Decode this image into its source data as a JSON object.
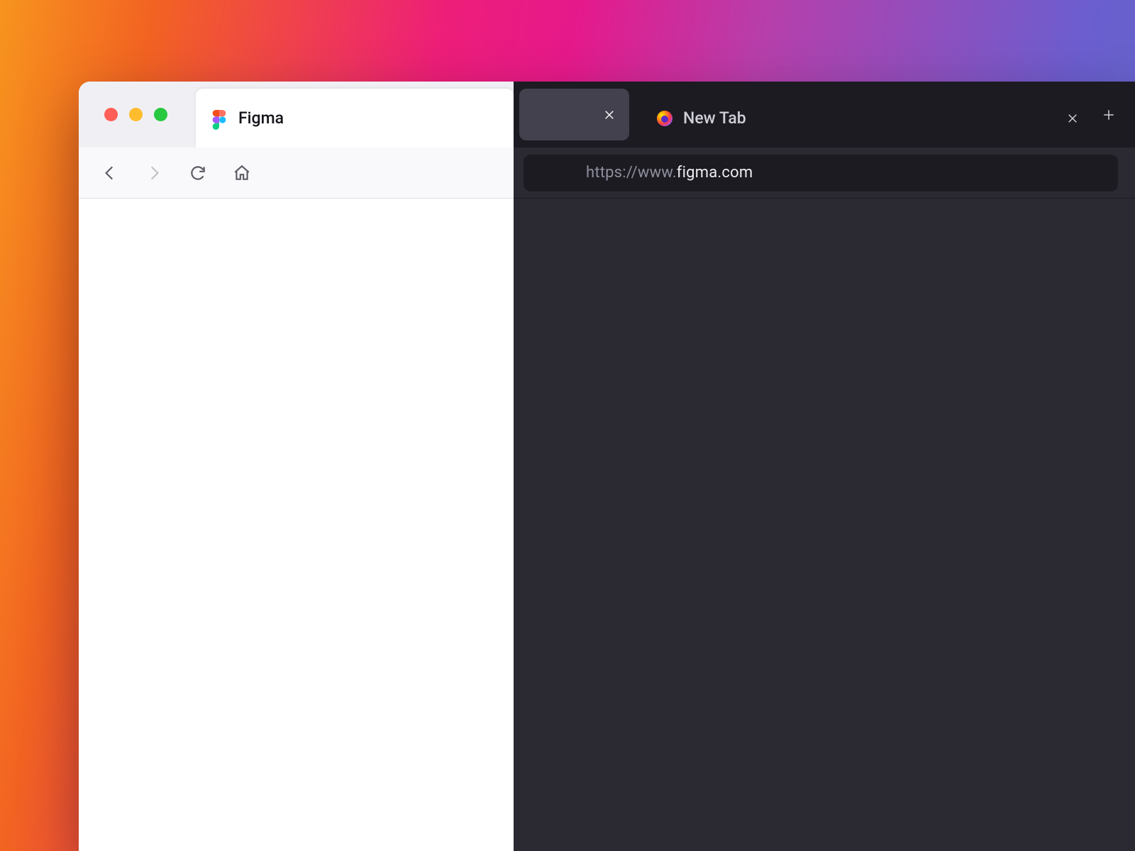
{
  "window": {
    "tabs": [
      {
        "label": "Figma",
        "favicon": "figma",
        "active": true,
        "theme": "light"
      },
      {
        "label": "New Tab",
        "favicon": "firefox",
        "active": false,
        "theme": "dark"
      }
    ]
  },
  "toolbar": {
    "back_enabled": true,
    "forward_enabled": false,
    "url_prefix": "https://www.",
    "url_domain": "figma.com",
    "url_suffix": ""
  }
}
